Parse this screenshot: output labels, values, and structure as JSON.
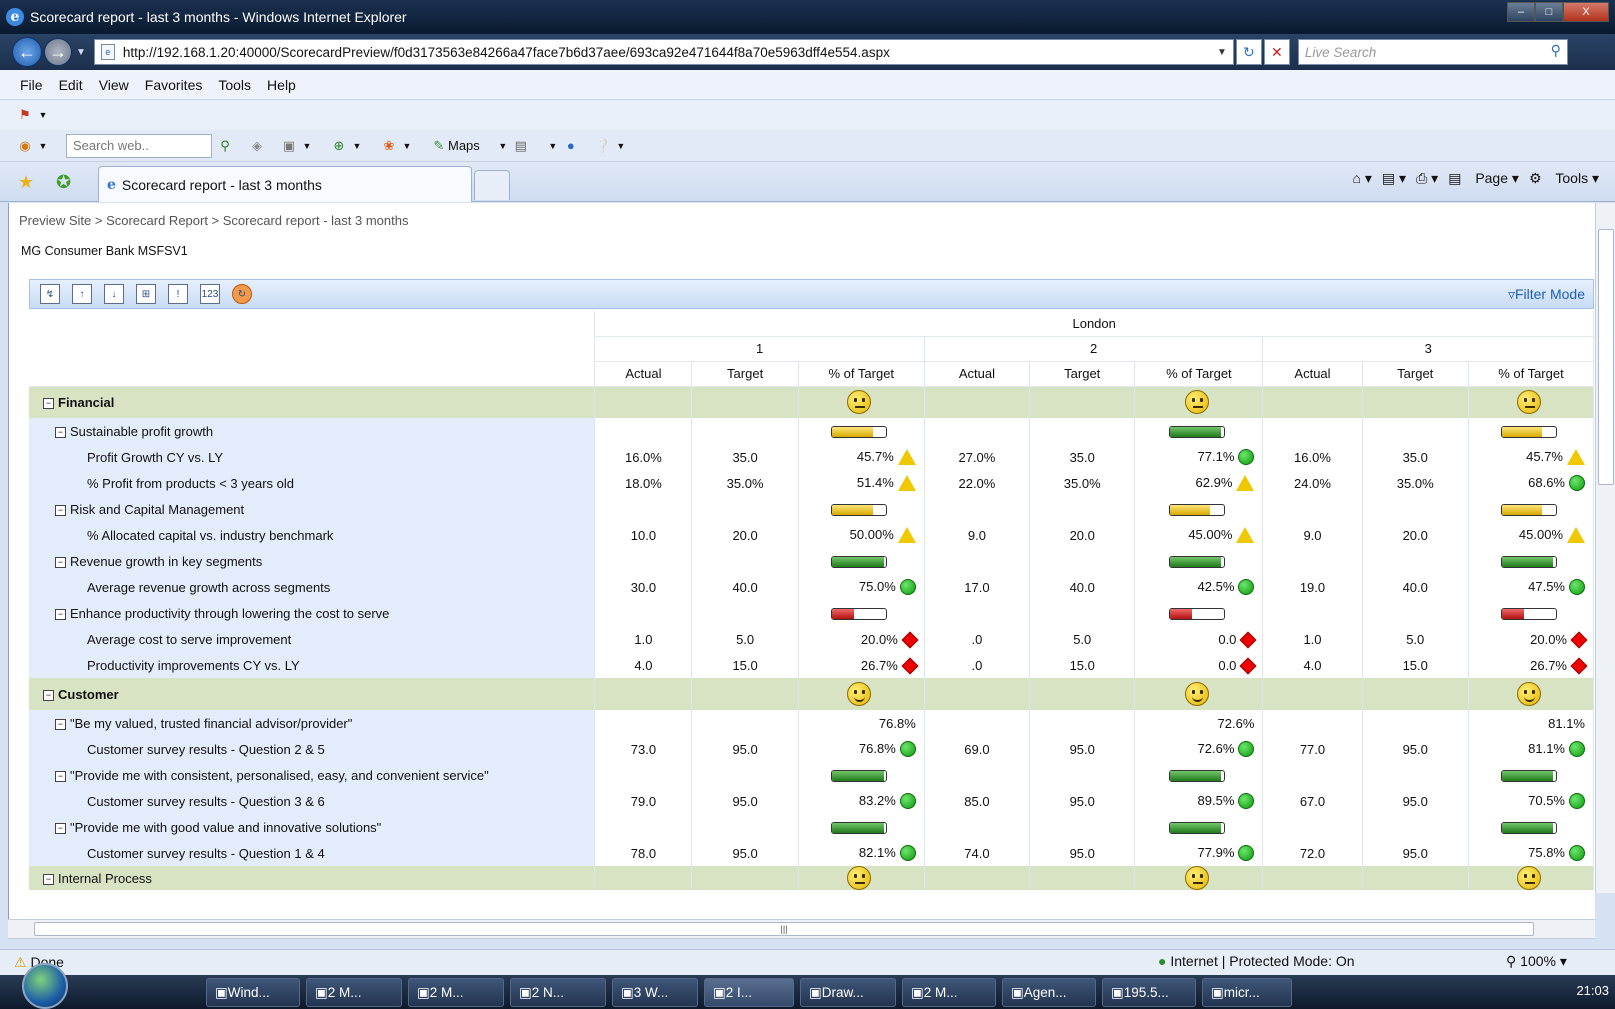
{
  "window": {
    "title": "Scorecard report - last 3 months - Windows Internet Explorer",
    "minimize": "–",
    "maximize": "□",
    "close": "X"
  },
  "address": {
    "url": "http://192.168.1.20:40000/ScorecardPreview/f0d3173563e84266a47face7b6d37aee/693ca92e471644f8a70e5963dff4e554.aspx",
    "search_placeholder": "Live Search"
  },
  "menu": [
    "File",
    "Edit",
    "View",
    "Favorites",
    "Tools",
    "Help"
  ],
  "toolbar2": {
    "search_placeholder": "Search web..",
    "maps_label": "Maps"
  },
  "tab": {
    "label": "Scorecard report - last 3 months"
  },
  "command_bar": {
    "page_label": "Page",
    "tools_label": "Tools"
  },
  "breadcrumb": "Preview Site  > Scorecard Report  > Scorecard report - last 3 months",
  "site_name": "MG Consumer Bank MSFSV1",
  "scorecard_toolbar": {
    "filter_mode": "Filter Mode"
  },
  "table": {
    "region": "London",
    "periods": [
      "1",
      "2",
      "3"
    ],
    "column_headers": [
      "Actual",
      "Target",
      "% of Target"
    ],
    "rows": [
      {
        "type": "cat",
        "label": "Financial",
        "cells": [
          [
            "",
            "",
            "smiley:neutral"
          ],
          [
            "",
            "",
            "smiley:neutral"
          ],
          [
            "",
            "",
            "smiley:neutral"
          ]
        ]
      },
      {
        "type": "obj",
        "label": "Sustainable profit growth",
        "cells": [
          [
            "",
            "",
            "bar:y:0.75"
          ],
          [
            "",
            "",
            "bar:g:0.95"
          ],
          [
            "",
            "",
            "bar:y:0.75"
          ]
        ]
      },
      {
        "type": "kpi",
        "label": "Profit Growth CY vs. LY",
        "cells": [
          [
            "16.0%",
            "35.0",
            "45.7%|yellow"
          ],
          [
            "27.0%",
            "35.0",
            "77.1%|green"
          ],
          [
            "16.0%",
            "35.0",
            "45.7%|yellow"
          ]
        ]
      },
      {
        "type": "kpi",
        "label": "% Profit from products < 3 years old",
        "cells": [
          [
            "18.0%",
            "35.0%",
            "51.4%|yellow"
          ],
          [
            "22.0%",
            "35.0%",
            "62.9%|yellow"
          ],
          [
            "24.0%",
            "35.0%",
            "68.6%|green"
          ]
        ]
      },
      {
        "type": "obj",
        "label": "Risk and Capital Management",
        "cells": [
          [
            "",
            "",
            "bar:y:0.75"
          ],
          [
            "",
            "",
            "bar:y:0.75"
          ],
          [
            "",
            "",
            "bar:y:0.75"
          ]
        ]
      },
      {
        "type": "kpi",
        "label": "% Allocated capital vs. industry benchmark",
        "cells": [
          [
            "10.0",
            "20.0",
            "50.00%|yellow"
          ],
          [
            "9.0",
            "20.0",
            "45.00%|yellow"
          ],
          [
            "9.0",
            "20.0",
            "45.00%|yellow"
          ]
        ]
      },
      {
        "type": "obj",
        "label": "Revenue growth in key segments",
        "cells": [
          [
            "",
            "",
            "bar:g:0.95"
          ],
          [
            "",
            "",
            "bar:g:0.95"
          ],
          [
            "",
            "",
            "bar:g:0.95"
          ]
        ]
      },
      {
        "type": "kpi",
        "label": "Average revenue growth across segments",
        "cells": [
          [
            "30.0",
            "40.0",
            "75.0%|green"
          ],
          [
            "17.0",
            "40.0",
            "42.5%|green"
          ],
          [
            "19.0",
            "40.0",
            "47.5%|green"
          ]
        ]
      },
      {
        "type": "obj",
        "label": "Enhance productivity through lowering the cost to serve",
        "cells": [
          [
            "",
            "",
            "bar:r:0.4"
          ],
          [
            "",
            "",
            "bar:r:0.4"
          ],
          [
            "",
            "",
            "bar:r:0.4"
          ]
        ]
      },
      {
        "type": "kpi",
        "label": "Average cost to serve improvement",
        "cells": [
          [
            "1.0",
            "5.0",
            "20.0%|red"
          ],
          [
            ".0",
            "5.0",
            "0.0|red"
          ],
          [
            "1.0",
            "5.0",
            "20.0%|red"
          ]
        ]
      },
      {
        "type": "kpi",
        "label": "Productivity improvements CY vs. LY",
        "cells": [
          [
            "4.0",
            "15.0",
            "26.7%|red"
          ],
          [
            ".0",
            "15.0",
            "0.0|red"
          ],
          [
            "4.0",
            "15.0",
            "26.7%|red"
          ]
        ]
      },
      {
        "type": "cat",
        "label": "Customer",
        "cells": [
          [
            "",
            "",
            "smiley:happy"
          ],
          [
            "",
            "",
            "smiley:happy"
          ],
          [
            "",
            "",
            "smiley:happy"
          ]
        ]
      },
      {
        "type": "obj",
        "label": "\"Be my valued, trusted financial advisor/provider\"",
        "cells": [
          [
            "",
            "",
            "76.8%"
          ],
          [
            "",
            "",
            "72.6%"
          ],
          [
            "",
            "",
            "81.1%"
          ]
        ]
      },
      {
        "type": "kpi",
        "label": "Customer survey results - Question 2 & 5",
        "cells": [
          [
            "73.0",
            "95.0",
            "76.8%|green"
          ],
          [
            "69.0",
            "95.0",
            "72.6%|green"
          ],
          [
            "77.0",
            "95.0",
            "81.1%|green"
          ]
        ]
      },
      {
        "type": "obj",
        "label": "\"Provide me with consistent, personalised, easy, and convenient service\"",
        "cells": [
          [
            "",
            "",
            "bar:g:0.95"
          ],
          [
            "",
            "",
            "bar:g:0.95"
          ],
          [
            "",
            "",
            "bar:g:0.95"
          ]
        ]
      },
      {
        "type": "kpi",
        "label": "Customer survey results - Question 3 & 6",
        "cells": [
          [
            "79.0",
            "95.0",
            "83.2%|green"
          ],
          [
            "85.0",
            "95.0",
            "89.5%|green"
          ],
          [
            "67.0",
            "95.0",
            "70.5%|green"
          ]
        ]
      },
      {
        "type": "obj",
        "label": "\"Provide me with good value and innovative solutions\"",
        "cells": [
          [
            "",
            "",
            "bar:g:0.95"
          ],
          [
            "",
            "",
            "bar:g:0.95"
          ],
          [
            "",
            "",
            "bar:g:0.95"
          ]
        ]
      },
      {
        "type": "kpi",
        "label": "Customer survey results - Question 1 & 4",
        "cells": [
          [
            "78.0",
            "95.0",
            "82.1%|green"
          ],
          [
            "74.0",
            "95.0",
            "77.9%|green"
          ],
          [
            "72.0",
            "95.0",
            "75.8%|green"
          ]
        ]
      },
      {
        "type": "cat2",
        "label": "Internal Process",
        "cells": [
          [
            "",
            "",
            "smiley:neutral"
          ],
          [
            "",
            "",
            "smiley:neutral"
          ],
          [
            "",
            "",
            "smiley:neutral"
          ]
        ]
      }
    ]
  },
  "status": {
    "text": "Done",
    "zone": "Internet | Protected Mode: On",
    "zoom": "100%"
  },
  "taskbar": {
    "buttons": [
      "Wind...",
      "2 M...",
      "2 M...",
      "2 N...",
      "3 W...",
      "2 I...",
      "Draw...",
      "2 M...",
      "Agen...",
      "195.5...",
      "micr..."
    ],
    "clock": "21:03"
  },
  "colors": {
    "category_row": "#d7e3c2",
    "label_column": "#e3ecfa",
    "toolbar_blue": "#c8dbf4",
    "titlebar": "#0a1a30"
  }
}
